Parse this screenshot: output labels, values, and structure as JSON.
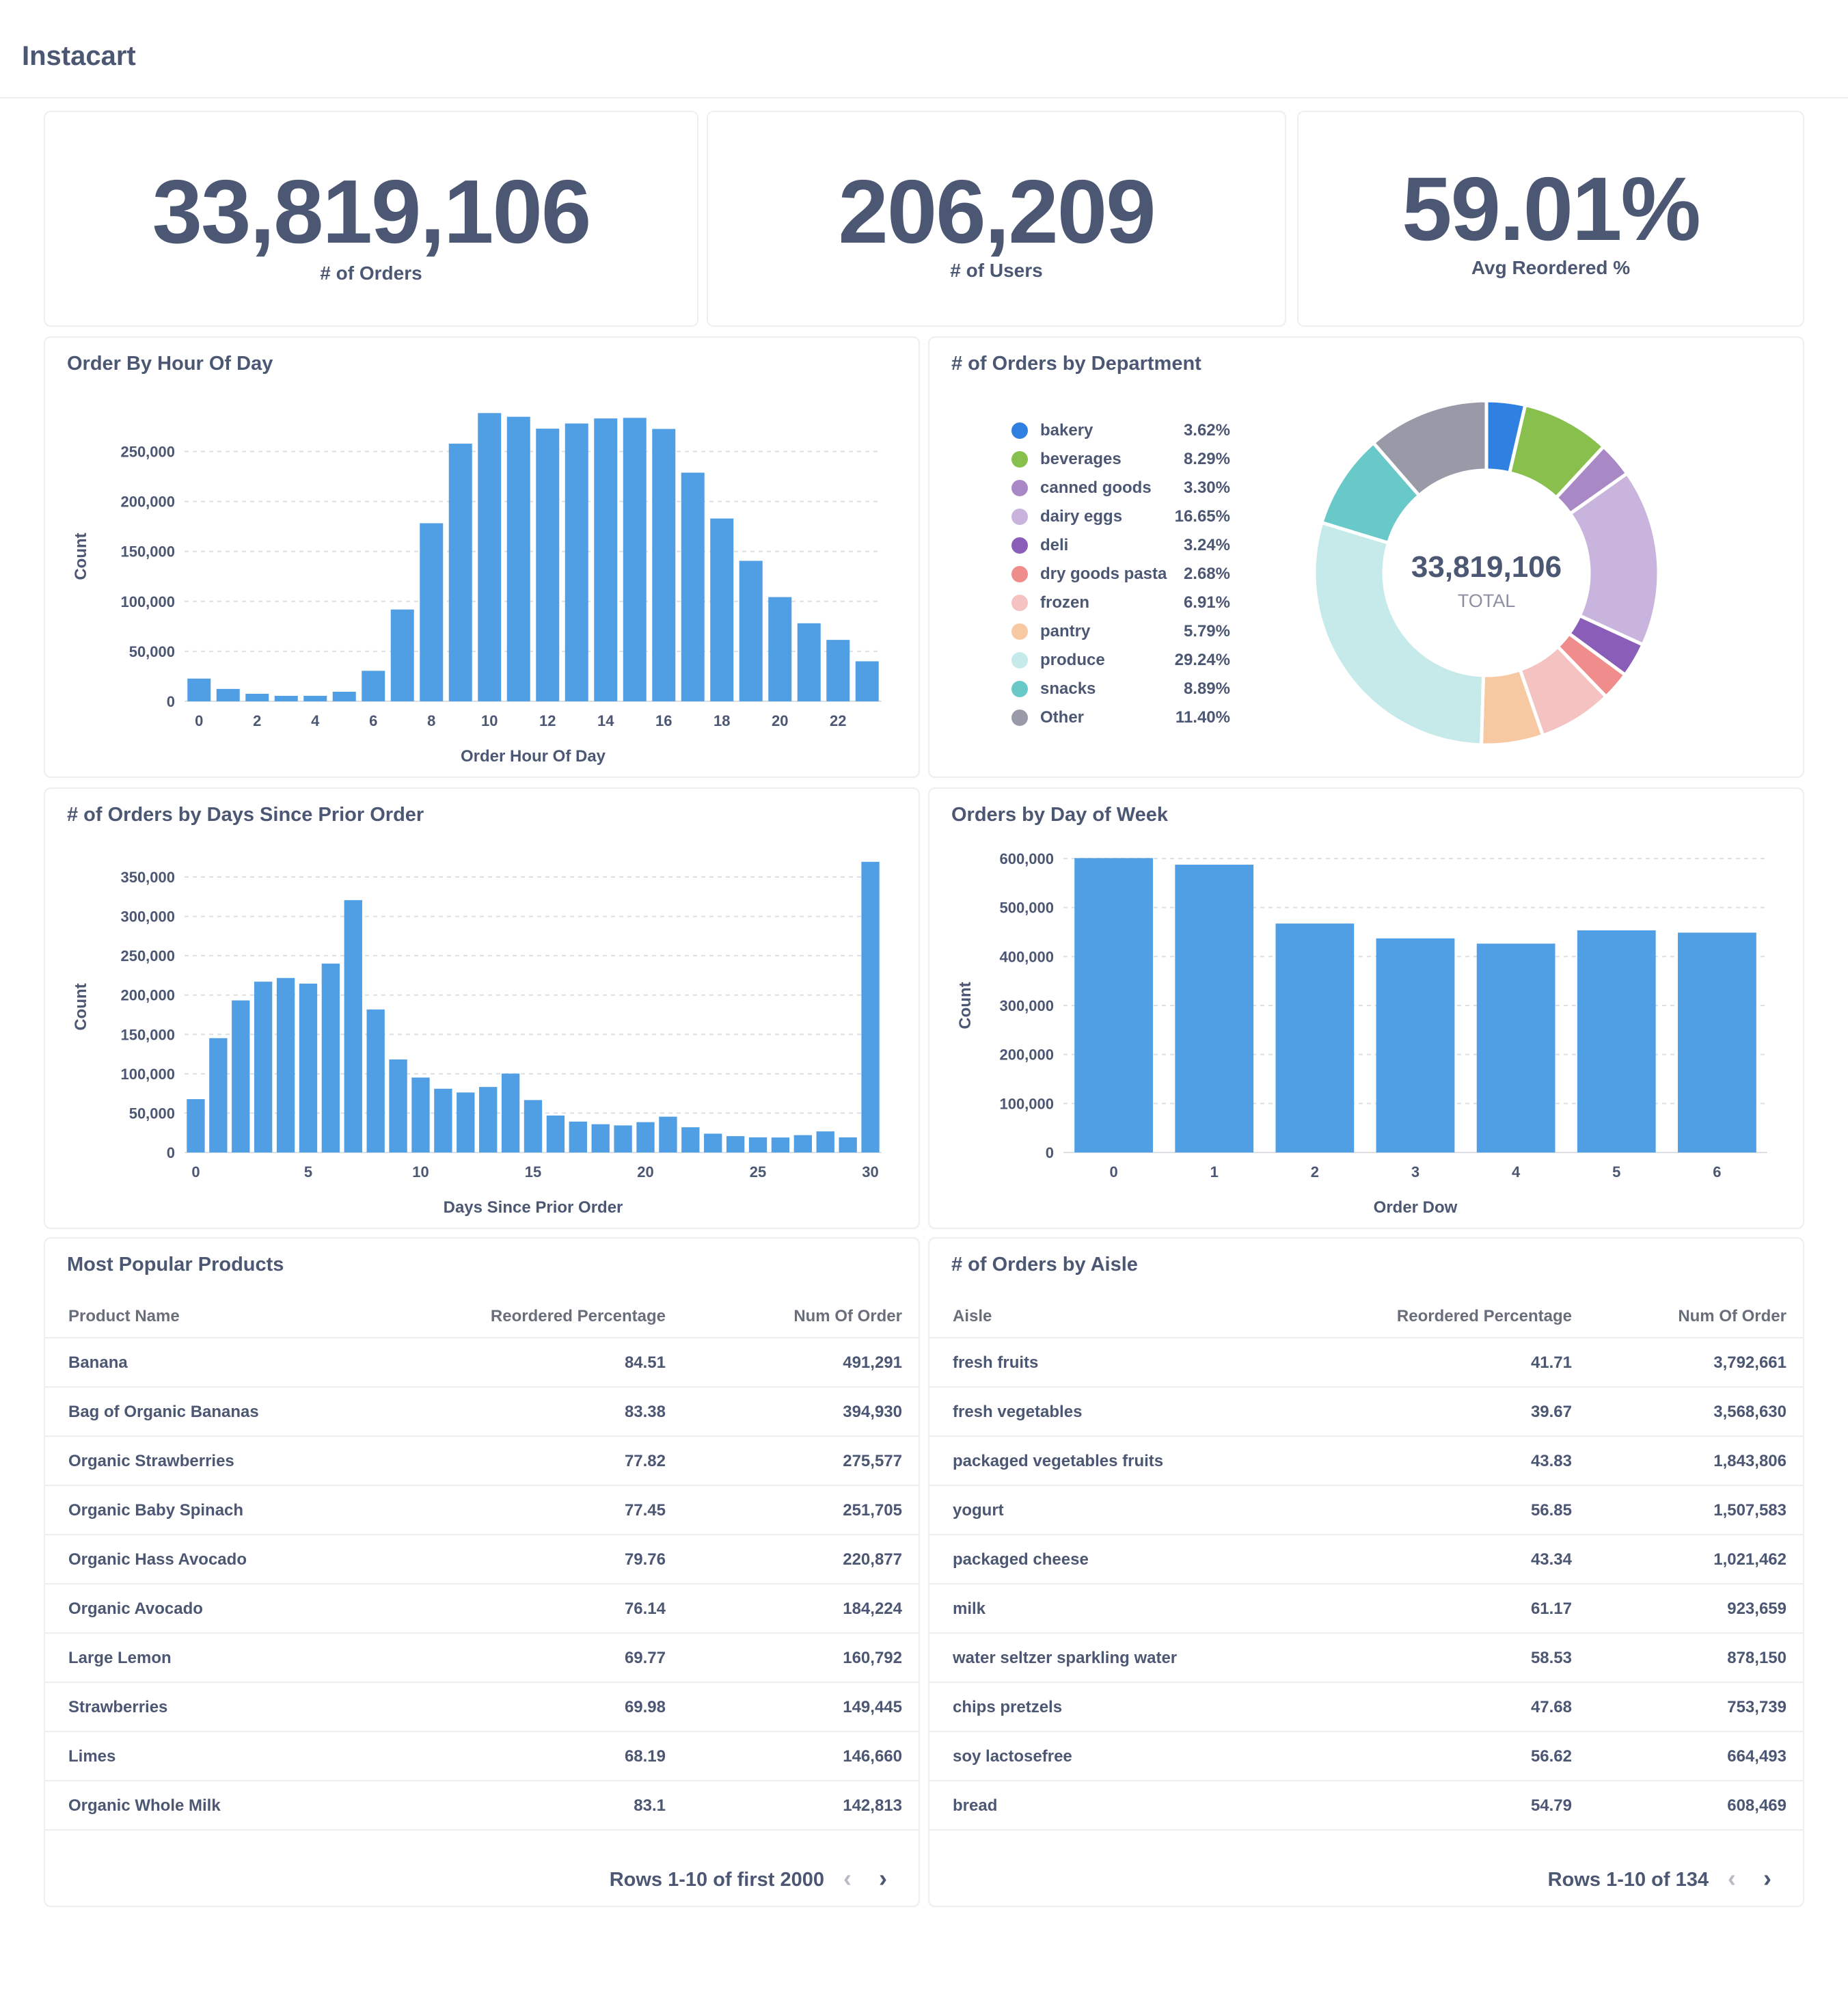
{
  "app": {
    "title": "Instacart"
  },
  "scalars": [
    {
      "value": "33,819,106",
      "label": "# of Orders"
    },
    {
      "value": "206,209",
      "label": "# of Users"
    },
    {
      "value": "59.01%",
      "label": "Avg Reordered %"
    }
  ],
  "chart_data": [
    {
      "type": "bar",
      "title": "Order By Hour Of Day",
      "xlabel": "Order Hour Of Day",
      "ylabel": "Count",
      "x": [
        0,
        1,
        2,
        3,
        4,
        5,
        6,
        7,
        8,
        9,
        10,
        11,
        12,
        13,
        14,
        15,
        16,
        17,
        18,
        19,
        20,
        21,
        22,
        23
      ],
      "values": [
        22758,
        12398,
        7539,
        5474,
        5527,
        9569,
        30529,
        91868,
        178201,
        257812,
        288418,
        284728,
        272841,
        277999,
        283042,
        283639,
        272553,
        228795,
        182912,
        140569,
        104292,
        78109,
        61468,
        40043
      ],
      "xticks": [
        "0",
        "2",
        "4",
        "6",
        "8",
        "10",
        "12",
        "14",
        "16",
        "18",
        "20",
        "22"
      ],
      "yticks": [
        "0",
        "50,000",
        "100,000",
        "150,000",
        "200,000",
        "250,000"
      ],
      "ylim": [
        0,
        290000
      ],
      "grid": true,
      "color": "#509ee3"
    },
    {
      "type": "pie",
      "title": "# of Orders by Department",
      "center_value": "33,819,106",
      "center_label": "TOTAL",
      "legend_position": "left",
      "slices": [
        {
          "name": "bakery",
          "pct_label": "3.62%",
          "value": 3.62,
          "color": "#2f80e0"
        },
        {
          "name": "beverages",
          "pct_label": "8.29%",
          "value": 8.29,
          "color": "#88bf4d"
        },
        {
          "name": "canned goods",
          "pct_label": "3.30%",
          "value": 3.3,
          "color": "#a989c5"
        },
        {
          "name": "dairy eggs",
          "pct_label": "16.65%",
          "value": 16.65,
          "color": "#c9b4dd"
        },
        {
          "name": "deli",
          "pct_label": "3.24%",
          "value": 3.24,
          "color": "#8a5eb8"
        },
        {
          "name": "dry goods pasta",
          "pct_label": "2.68%",
          "value": 2.68,
          "color": "#ef8c8c"
        },
        {
          "name": "frozen",
          "pct_label": "6.91%",
          "value": 6.91,
          "color": "#f5c2c2"
        },
        {
          "name": "pantry",
          "pct_label": "5.79%",
          "value": 5.79,
          "color": "#f7c9a3"
        },
        {
          "name": "produce",
          "pct_label": "29.24%",
          "value": 29.24,
          "color": "#c6eaea"
        },
        {
          "name": "snacks",
          "pct_label": "8.89%",
          "value": 8.89,
          "color": "#69c8c8"
        },
        {
          "name": "Other",
          "pct_label": "11.40%",
          "value": 11.4,
          "color": "#989aa8"
        }
      ]
    },
    {
      "type": "bar",
      "title": "# of Orders by Days Since Prior Order",
      "xlabel": "Days Since Prior Order",
      "ylabel": "Count",
      "x": [
        0,
        1,
        2,
        3,
        4,
        5,
        6,
        7,
        8,
        9,
        10,
        11,
        12,
        13,
        14,
        15,
        16,
        17,
        18,
        19,
        20,
        21,
        22,
        23,
        24,
        25,
        26,
        27,
        28,
        29,
        30
      ],
      "values": [
        67755,
        145247,
        193206,
        217005,
        221696,
        214503,
        240013,
        320608,
        181717,
        118188,
        95186,
        80970,
        76200,
        83214,
        100230,
        66579,
        46941,
        39245,
        35881,
        34384,
        38527,
        45470,
        32012,
        23885,
        20712,
        19234,
        19016,
        22013,
        26777,
        19191,
        369323
      ],
      "xticks": [
        "0",
        "5",
        "10",
        "15",
        "20",
        "25",
        "30"
      ],
      "yticks": [
        "0",
        "50,000",
        "100,000",
        "150,000",
        "200,000",
        "250,000",
        "300,000",
        "350,000"
      ],
      "ylim": [
        0,
        370000
      ],
      "grid": true,
      "color": "#509ee3"
    },
    {
      "type": "bar",
      "title": "Orders by Day of Week",
      "xlabel": "Order Dow",
      "ylabel": "Count",
      "x": [
        0,
        1,
        2,
        3,
        4,
        5,
        6
      ],
      "values": [
        600905,
        587478,
        467260,
        436972,
        426339,
        453368,
        448761
      ],
      "xticks": [
        "0",
        "1",
        "2",
        "3",
        "4",
        "5",
        "6"
      ],
      "yticks": [
        "0",
        "100,000",
        "200,000",
        "300,000",
        "400,000",
        "500,000",
        "600,000"
      ],
      "ylim": [
        0,
        600000
      ],
      "grid": true,
      "color": "#509ee3"
    }
  ],
  "products": {
    "title": "Most Popular Products",
    "columns": [
      "Product Name",
      "Reordered Percentage",
      "Num Of Order"
    ],
    "rows": [
      [
        "Banana",
        "84.51",
        "491,291"
      ],
      [
        "Bag of Organic Bananas",
        "83.38",
        "394,930"
      ],
      [
        "Organic Strawberries",
        "77.82",
        "275,577"
      ],
      [
        "Organic Baby Spinach",
        "77.45",
        "251,705"
      ],
      [
        "Organic Hass Avocado",
        "79.76",
        "220,877"
      ],
      [
        "Organic Avocado",
        "76.14",
        "184,224"
      ],
      [
        "Large Lemon",
        "69.77",
        "160,792"
      ],
      [
        "Strawberries",
        "69.98",
        "149,445"
      ],
      [
        "Limes",
        "68.19",
        "146,660"
      ],
      [
        "Organic Whole Milk",
        "83.1",
        "142,813"
      ]
    ],
    "pager": "Rows 1-10 of first 2000"
  },
  "aisles": {
    "title": "# of Orders by Aisle",
    "columns": [
      "Aisle",
      "Reordered Percentage",
      "Num Of Order"
    ],
    "rows": [
      [
        "fresh fruits",
        "41.71",
        "3,792,661"
      ],
      [
        "fresh vegetables",
        "39.67",
        "3,568,630"
      ],
      [
        "packaged vegetables fruits",
        "43.83",
        "1,843,806"
      ],
      [
        "yogurt",
        "56.85",
        "1,507,583"
      ],
      [
        "packaged cheese",
        "43.34",
        "1,021,462"
      ],
      [
        "milk",
        "61.17",
        "923,659"
      ],
      [
        "water seltzer sparkling water",
        "58.53",
        "878,150"
      ],
      [
        "chips pretzels",
        "47.68",
        "753,739"
      ],
      [
        "soy lactosefree",
        "56.62",
        "664,493"
      ],
      [
        "bread",
        "54.79",
        "608,469"
      ]
    ],
    "pager": "Rows 1-10 of 134"
  },
  "icons": {
    "sort": "sort-arrow-icon",
    "prev": "chevron-left-icon",
    "next": "chevron-right-icon"
  },
  "colors": {
    "text": "#4c5773",
    "bar": "#509ee3",
    "border": "#eceff2"
  }
}
